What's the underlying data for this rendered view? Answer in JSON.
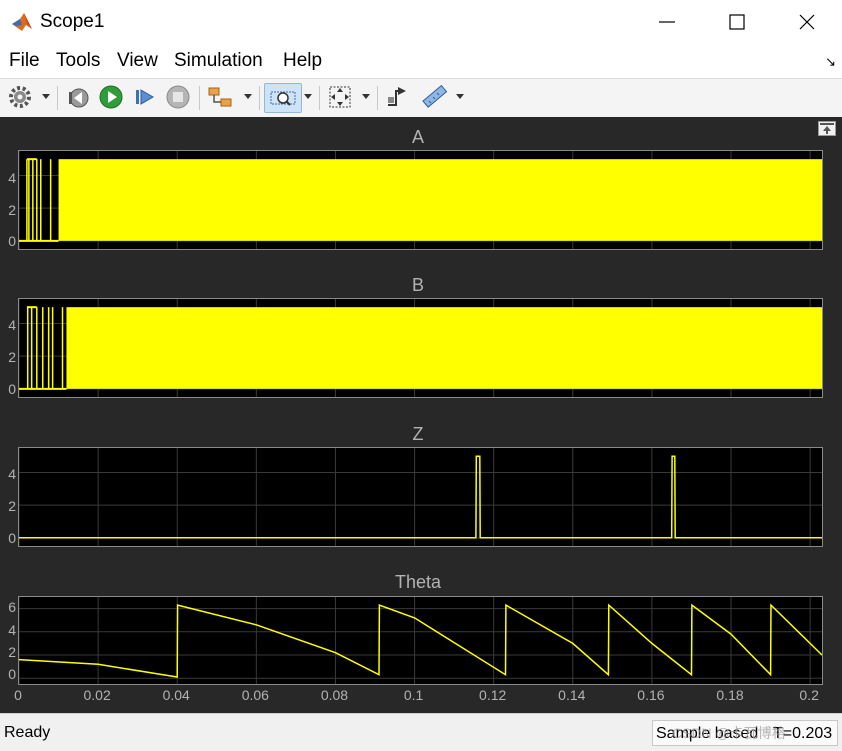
{
  "window": {
    "title": "Scope1",
    "app_icon": "matlab-icon",
    "controls": [
      "minimize-icon",
      "maximize-icon",
      "close-icon"
    ]
  },
  "menu": {
    "items": [
      "File",
      "Tools",
      "View",
      "Simulation",
      "Help"
    ],
    "dock_glyph": "↘"
  },
  "toolbar": {
    "buttons": [
      {
        "name": "settings-button",
        "icon": "gear-icon",
        "has_menu": true
      },
      {
        "name": "step-back-button",
        "icon": "step-back-icon",
        "has_menu": false
      },
      {
        "name": "run-button",
        "icon": "play-icon",
        "has_menu": false
      },
      {
        "name": "step-forward-button",
        "icon": "step-forward-icon",
        "has_menu": false
      },
      {
        "name": "stop-button",
        "icon": "stop-icon",
        "has_menu": false
      },
      {
        "name": "highlight-button",
        "icon": "highlight-block-icon",
        "has_menu": true
      },
      {
        "name": "zoom-button",
        "icon": "zoom-icon",
        "has_menu": true,
        "active": true
      },
      {
        "name": "scale-button",
        "icon": "fit-to-view-icon",
        "has_menu": true
      },
      {
        "name": "triggers-button",
        "icon": "triggers-icon",
        "has_menu": false
      },
      {
        "name": "cursor-measurements-button",
        "icon": "ruler-icon",
        "has_menu": true
      }
    ]
  },
  "plots": [
    {
      "title": "A",
      "yticks": [
        "4",
        "2",
        "0"
      ]
    },
    {
      "title": "B",
      "yticks": [
        "4",
        "2",
        "0"
      ]
    },
    {
      "title": "Z",
      "yticks": [
        "4",
        "2",
        "0"
      ]
    },
    {
      "title": "Theta",
      "yticks": [
        "6",
        "4",
        "2",
        "0"
      ]
    }
  ],
  "xaxis": {
    "ticks": [
      "0",
      "0.02",
      "0.04",
      "0.06",
      "0.08",
      "0.1",
      "0.12",
      "0.14",
      "0.16",
      "0.18",
      "0.2"
    ]
  },
  "status": {
    "left": "Ready",
    "mode": "Sample based",
    "time": "T=0.203"
  },
  "watermark": "CSDN @卡瓦博格",
  "colors": {
    "signal": "#ffff00",
    "plot_bg": "#000000",
    "scope_bg": "#282828",
    "grid": "#3a3a3a",
    "label": "#b3b3b3"
  },
  "chart_data": [
    {
      "type": "line",
      "title": "A",
      "xlim": [
        0,
        0.203
      ],
      "ylim": [
        -0.5,
        5.5
      ],
      "description_values": {
        "low": 0,
        "high": 5
      },
      "x": [
        0,
        0.003,
        0.003,
        0.005,
        0.01,
        0.203
      ],
      "y": [
        0,
        0,
        5,
        0,
        5,
        5
      ],
      "grid": true
    },
    {
      "type": "line",
      "title": "B",
      "xlim": [
        0,
        0.203
      ],
      "ylim": [
        -0.5,
        5.5
      ],
      "x": [
        0,
        0.003,
        0.003,
        0.009,
        0.012,
        0.203
      ],
      "y": [
        0,
        0,
        5,
        0,
        5,
        5
      ],
      "grid": true
    },
    {
      "type": "line",
      "title": "Z",
      "xlim": [
        0,
        0.203
      ],
      "ylim": [
        -0.5,
        5.5
      ],
      "x": [
        0,
        0.1155,
        0.1156,
        0.1165,
        0.1166,
        0.165,
        0.1651,
        0.1658,
        0.1659,
        0.203
      ],
      "y": [
        0,
        0,
        5,
        5,
        0,
        0,
        5,
        5,
        0,
        0
      ],
      "grid": true
    },
    {
      "type": "line",
      "title": "Theta",
      "xlim": [
        0,
        0.203
      ],
      "ylim": [
        -0.5,
        7
      ],
      "x": [
        0,
        0.02,
        0.04,
        0.0401,
        0.06,
        0.08,
        0.091,
        0.0911,
        0.1,
        0.123,
        0.1231,
        0.14,
        0.149,
        0.1491,
        0.16,
        0.17,
        0.1701,
        0.18,
        0.19,
        0.1901,
        0.203
      ],
      "y": [
        1.6,
        1.2,
        0.1,
        6.3,
        4.6,
        2.2,
        0.3,
        6.3,
        5.2,
        0.3,
        6.3,
        3.0,
        0.3,
        6.3,
        3.0,
        0.3,
        6.3,
        3.8,
        0.3,
        6.3,
        2.0
      ],
      "grid": true
    }
  ]
}
